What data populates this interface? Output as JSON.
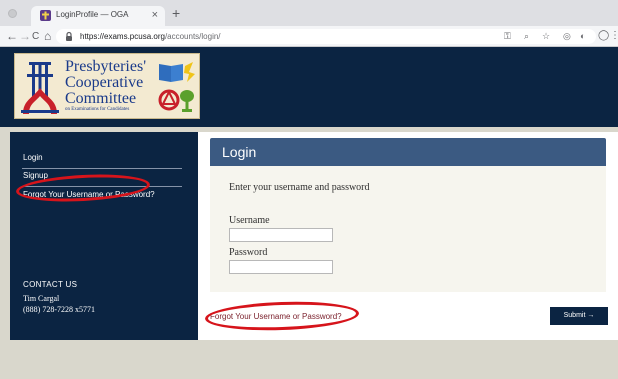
{
  "browser": {
    "tab_title": "LoginProfile — OGA",
    "tab_close": "×",
    "new_tab": "+",
    "nav_back": "←",
    "nav_forward": "→",
    "nav_reload": "C",
    "nav_home": "⌂",
    "url_host": "https://exams.pcusa.org",
    "url_path": "/accounts/login/",
    "omnibox_icons": [
      "key-icon",
      "zoom-icon",
      "star-icon",
      "extension-icon",
      "extension-icon",
      "profile-icon"
    ],
    "menu": "⋮"
  },
  "logo": {
    "line1": "Presbyteries'",
    "line2": "Cooperative",
    "line3": "Committee",
    "subtitle": "on Examinations for Candidates"
  },
  "sidebar": {
    "items": [
      {
        "label": "Login"
      },
      {
        "label": "Signup"
      },
      {
        "label": "Forgot Your Username or Password?"
      }
    ],
    "contact_title": "CONTACT US",
    "contact_name": "Tim Cargal",
    "contact_phone": "(888) 728-7228 x5771"
  },
  "main": {
    "title": "Login",
    "prompt": "Enter your username and password",
    "username_label": "Username",
    "username_value": "",
    "password_label": "Password",
    "password_value": "",
    "forgot_link": "Forgot Your Username or Password?",
    "submit_label": "Submit →"
  },
  "colors": {
    "header_navy": "#0b2442",
    "panel_blue": "#3b5a82",
    "link_maroon": "#7a1f2b",
    "highlight_red": "#d6141b"
  }
}
